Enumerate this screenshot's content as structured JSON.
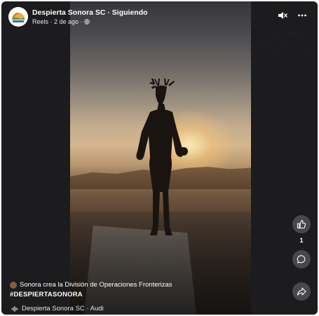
{
  "header": {
    "page_name": "Despierta Sonora SC",
    "separator": " · ",
    "follow_status": "Siguiendo",
    "meta": "Reels · 2 de ago ·",
    "avatar_icon": "despierta-sonora-logo",
    "privacy_icon": "globe-icon"
  },
  "controls": {
    "mute_icon": "speaker-muted-icon",
    "more_icon": "more-dots-icon"
  },
  "actions": {
    "like_icon": "thumbs-up-icon",
    "like_count": "1",
    "comment_icon": "comment-bubble-icon",
    "share_icon": "share-arrow-icon"
  },
  "caption": {
    "text": "Sonora crea la División de Operaciones Fronterizas",
    "hashtag": "#DESPIERTASONORA"
  },
  "audio": {
    "icon": "audio-waveform-icon",
    "label": "Despierta Sonora SC · Audi"
  },
  "colors": {
    "frame_background": "#1c1c1e",
    "button_background": "#505055",
    "text": "#ffffff"
  }
}
